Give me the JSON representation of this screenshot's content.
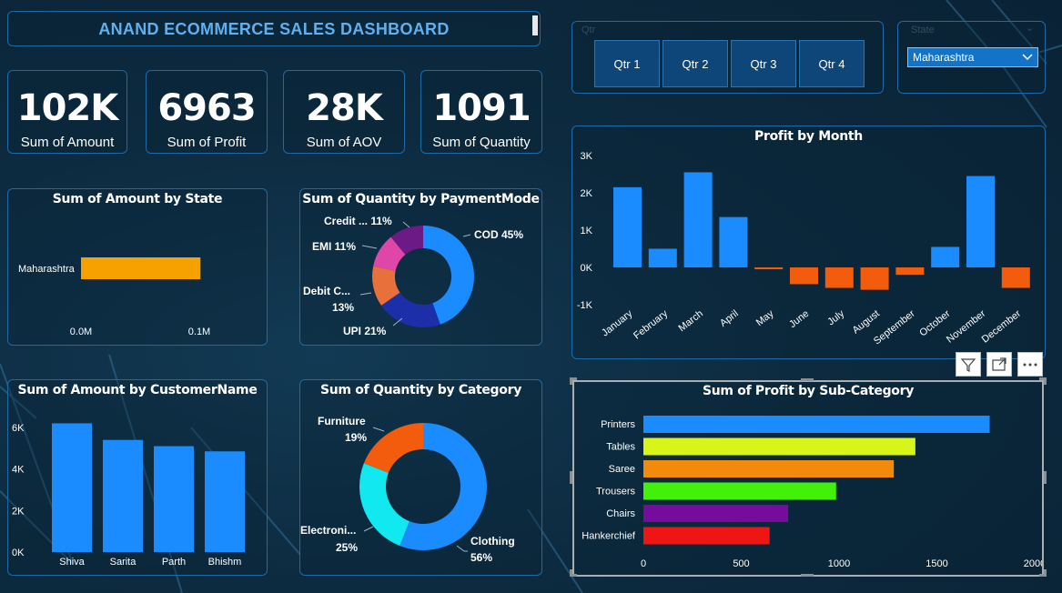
{
  "header": {
    "title": "ANAND ECOMMERCE SALES DASHBOARD"
  },
  "kpis": [
    {
      "value": "102K",
      "label": "Sum of Amount"
    },
    {
      "value": "6963",
      "label": "Sum of Profit"
    },
    {
      "value": "28K",
      "label": "Sum of AOV"
    },
    {
      "value": "1091",
      "label": "Sum of Quantity"
    }
  ],
  "slicers": {
    "quarter_label": "Qtr",
    "quarters": [
      "Qtr 1",
      "Qtr 2",
      "Qtr 3",
      "Qtr 4"
    ],
    "state_label": "State",
    "state_selected": "Maharashtra"
  },
  "colors": {
    "accent": "#1a8cff",
    "negative": "#f25c0c",
    "state_bar": "#f7a100",
    "border": "#1e6aa8"
  },
  "toolbar": {
    "icons": [
      "filter-icon",
      "focus-mode-icon",
      "more-options-icon"
    ]
  },
  "chart_data": [
    {
      "id": "amount_by_state",
      "type": "bar",
      "orientation": "horizontal",
      "title": "Sum of Amount by State",
      "categories": [
        "Maharashtra"
      ],
      "values": [
        0.101
      ],
      "value_unit": "M",
      "xlim": [
        0,
        0.1
      ],
      "ticks": [
        "0.0M",
        "0.1M"
      ]
    },
    {
      "id": "quantity_by_paymentmode",
      "type": "pie",
      "donut": true,
      "title": "Sum of Quantity by PaymentMode",
      "slices": [
        {
          "name": "COD",
          "label": "COD 45%",
          "value": 45,
          "color": "#1a8cff"
        },
        {
          "name": "UPI",
          "label": "UPI 21%",
          "value": 21,
          "color": "#1c2fa8"
        },
        {
          "name": "Debit Card",
          "label": "Debit C...",
          "label2": "13%",
          "value": 13,
          "color": "#e8703a"
        },
        {
          "name": "EMI",
          "label": "EMI 11%",
          "value": 11,
          "color": "#e046a8"
        },
        {
          "name": "Credit Card",
          "label": "Credit ... 11%",
          "value": 11,
          "color": "#6b1a86"
        }
      ]
    },
    {
      "id": "profit_by_month",
      "type": "bar",
      "title": "Profit by Month",
      "categories": [
        "January",
        "February",
        "March",
        "April",
        "May",
        "June",
        "July",
        "August",
        "September",
        "October",
        "November",
        "December"
      ],
      "values": [
        2150,
        500,
        2550,
        1350,
        -50,
        -450,
        -550,
        -600,
        -200,
        550,
        2450,
        -550
      ],
      "ylim": [
        -1000,
        3000
      ],
      "yticks": [
        -1000,
        0,
        1000,
        2000,
        3000
      ],
      "ytick_labels": [
        "-1K",
        "0K",
        "1K",
        "2K",
        "3K"
      ]
    },
    {
      "id": "amount_by_customer",
      "type": "bar",
      "title": "Sum of Amount by CustomerName",
      "categories": [
        "Shiva",
        "Sarita",
        "Parth",
        "Bhishm"
      ],
      "values": [
        6200,
        5400,
        5100,
        4850
      ],
      "ylim": [
        0,
        6000
      ],
      "yticks": [
        0,
        2000,
        4000,
        6000
      ],
      "ytick_labels": [
        "0K",
        "2K",
        "4K",
        "6K"
      ]
    },
    {
      "id": "quantity_by_category",
      "type": "pie",
      "donut": true,
      "title": "Sum of Quantity by Category",
      "slices": [
        {
          "name": "Clothing",
          "label": "Clothing",
          "pct": "56%",
          "value": 56,
          "color": "#1a8cff"
        },
        {
          "name": "Electronics",
          "label": "Electroni...",
          "pct": "25%",
          "value": 25,
          "color": "#12e8f0"
        },
        {
          "name": "Furniture",
          "label": "Furniture",
          "pct": "19%",
          "value": 19,
          "color": "#f25c0c"
        }
      ]
    },
    {
      "id": "profit_by_subcategory",
      "type": "bar",
      "orientation": "horizontal",
      "title": "Sum of Profit by Sub-Category",
      "categories": [
        "Printers",
        "Tables",
        "Saree",
        "Trousers",
        "Chairs",
        "Hankerchief"
      ],
      "values": [
        1770,
        1390,
        1280,
        985,
        740,
        645
      ],
      "colors": [
        "#1a8cff",
        "#d8f51a",
        "#f28a0c",
        "#42f00a",
        "#760c9c",
        "#f01515"
      ],
      "xlim": [
        0,
        2000
      ],
      "xticks": [
        0,
        500,
        1000,
        1500,
        2000
      ]
    }
  ]
}
